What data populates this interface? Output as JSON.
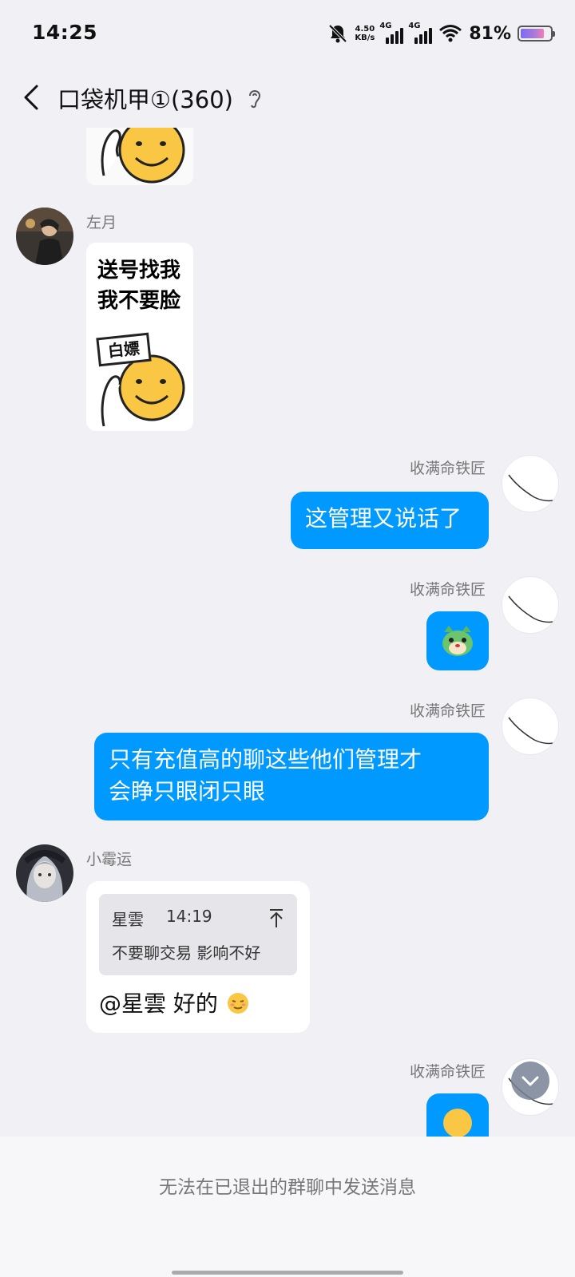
{
  "status_bar": {
    "time": "14:25",
    "speed_value": "4.50",
    "speed_unit": "KB/s",
    "sim1_label": "4G",
    "sim2_label": "4G",
    "battery_percent": "81%",
    "battery_level": 0.81,
    "icons": [
      "bell-muted-icon",
      "signal-icon",
      "wifi-icon",
      "battery-icon"
    ]
  },
  "header": {
    "title": "口袋机甲①(360)",
    "icons": [
      "back-arrow-icon",
      "ear-icon"
    ]
  },
  "messages": [
    {
      "sender": "左月",
      "sticker_lines": [
        "送号找我",
        "我不要脸"
      ],
      "sign_text": "白嫖"
    },
    {
      "sender": "收满命铁匠",
      "text": "这管理又说话了"
    },
    {
      "sender": "收满命铁匠",
      "emoji": "green-cat-emoji"
    },
    {
      "sender": "收满命铁匠",
      "text_line1": "只有充值高的聊这些他们管理才",
      "text_line2": "会睁只眼闭只眼"
    },
    {
      "sender": "小霉运",
      "quote": {
        "sender": "星雲",
        "time": "14:19",
        "text": "不要聊交易 影响不好"
      },
      "text": "@星雲 好的"
    },
    {
      "sender": "收满命铁匠"
    }
  ],
  "footer": {
    "notice": "无法在已退出的群聊中发送消息"
  },
  "colors": {
    "background": "#f0f0f5",
    "self_bubble": "#0099ff",
    "other_bubble": "#ffffff"
  }
}
